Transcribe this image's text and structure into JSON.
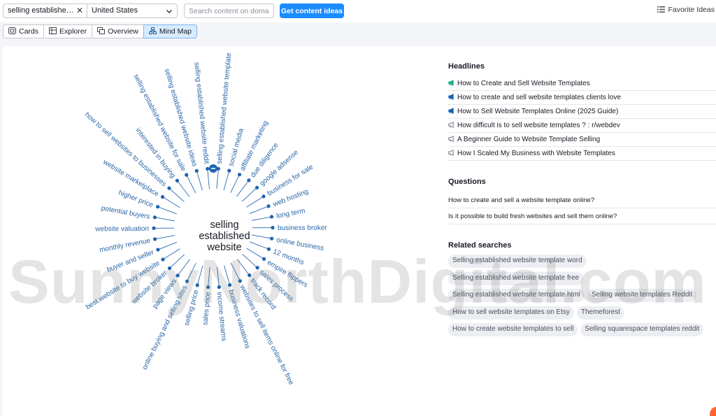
{
  "toolbar": {
    "keyword_value": "selling established ...",
    "country_value": "United States",
    "domain_placeholder": "Search content on domain",
    "get_ideas_label": "Get content ideas",
    "favorite_label": "Favorite Ideas"
  },
  "tabs": [
    {
      "label": "Cards",
      "icon": "cards-icon"
    },
    {
      "label": "Explorer",
      "icon": "table-icon"
    },
    {
      "label": "Overview",
      "icon": "overview-icon"
    },
    {
      "label": "Mind Map",
      "icon": "mindmap-icon",
      "active": true
    }
  ],
  "mindmap": {
    "center_lines": [
      "selling",
      "established",
      "website"
    ],
    "topics": [
      "selling established website template",
      "social media",
      "affiliate marketing",
      "due diligence",
      "google adsense",
      "business for sale",
      "web hosting",
      "long term",
      "business broker",
      "online business",
      "12 months",
      "empire flippers",
      "sales process",
      "track record",
      "websites to sell items online for free",
      "business valuations",
      "income streams",
      "sales price",
      "selling price",
      "online buying and selling sites",
      "page views",
      "website broker",
      "best website to buy website",
      "buyer and seller",
      "monthly revenue",
      "website valuation",
      "potential buyers",
      "higher price",
      "website marketplace",
      "how to sell websites to businesses",
      "interested in buying",
      "selling established website for sale",
      "selling established website ideas",
      "selling established website reddit"
    ]
  },
  "headlines": {
    "title": "Headlines",
    "items": [
      {
        "text": "How to Create and Sell Website Templates",
        "icon": "megaphone-icon",
        "color": "#1bb08a"
      },
      {
        "text": "How to create and sell website templates clients love",
        "icon": "megaphone-icon",
        "color": "#1a5fb4"
      },
      {
        "text": "How to Sell Website Templates Online (2025 Guide)",
        "icon": "megaphone-icon",
        "color": "#1a5fb4"
      },
      {
        "text": "How difficult is to sell website templates ? : r/webdev",
        "icon": "megaphone-outline-icon",
        "color": "#6b7080"
      },
      {
        "text": "A Beginner Guide to Website Template Selling",
        "icon": "megaphone-outline-icon",
        "color": "#6b7080"
      },
      {
        "text": "How I Scaled My Business with Website Templates",
        "icon": "megaphone-outline-icon",
        "color": "#6b7080"
      }
    ]
  },
  "questions": {
    "title": "Questions",
    "items": [
      "How to create and sell a website template online?",
      "Is it possible to build fresh websites and sell them online?"
    ]
  },
  "related": {
    "title": "Related searches",
    "rows": [
      [
        "Selling established website template word"
      ],
      [
        "Selling established website template free"
      ],
      [
        "Selling established website template html",
        "Selling website templates Reddit"
      ],
      [
        "How to sell website templates on Etsy",
        "Themeforest"
      ],
      [
        "How to create website templates to sell",
        "Selling squarespace templates reddit"
      ]
    ]
  },
  "watermark": "SunnyNorthDigital.com",
  "colors": {
    "accent": "#1a8cff",
    "link": "#2b66a8",
    "active_tab": "#d9ebff"
  }
}
